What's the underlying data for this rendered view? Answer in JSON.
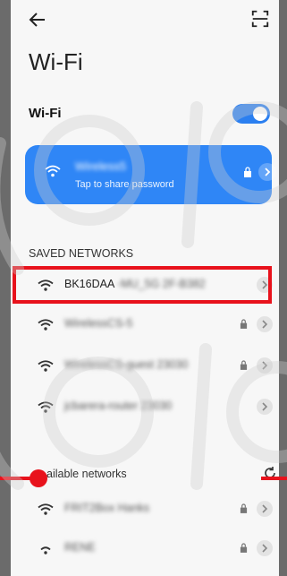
{
  "header": {
    "title": "Wi-Fi"
  },
  "wifi_toggle": {
    "label": "Wi-Fi",
    "on": true
  },
  "connected": {
    "ssid": "Wireless5",
    "subtitle": "Tap to share password"
  },
  "saved_section": {
    "label": "SAVED NETWORKS"
  },
  "saved_networks": [
    {
      "ssid": "BK16DAA",
      "suffix": "-MU_5G 2F-B382"
    },
    {
      "ssid": "WirelessCS-5"
    },
    {
      "ssid": "WirelessCS-guest",
      "suffix": "23030"
    },
    {
      "ssid": "jcbarera-router",
      "suffix": "23030"
    }
  ],
  "available_section": {
    "label": "ailable networks"
  },
  "available_networks": [
    {
      "ssid": "FRIT2Box Hanks"
    },
    {
      "ssid": "RENE"
    }
  ],
  "colors": {
    "accent": "#2f86f6",
    "highlight": "#e8121c"
  }
}
